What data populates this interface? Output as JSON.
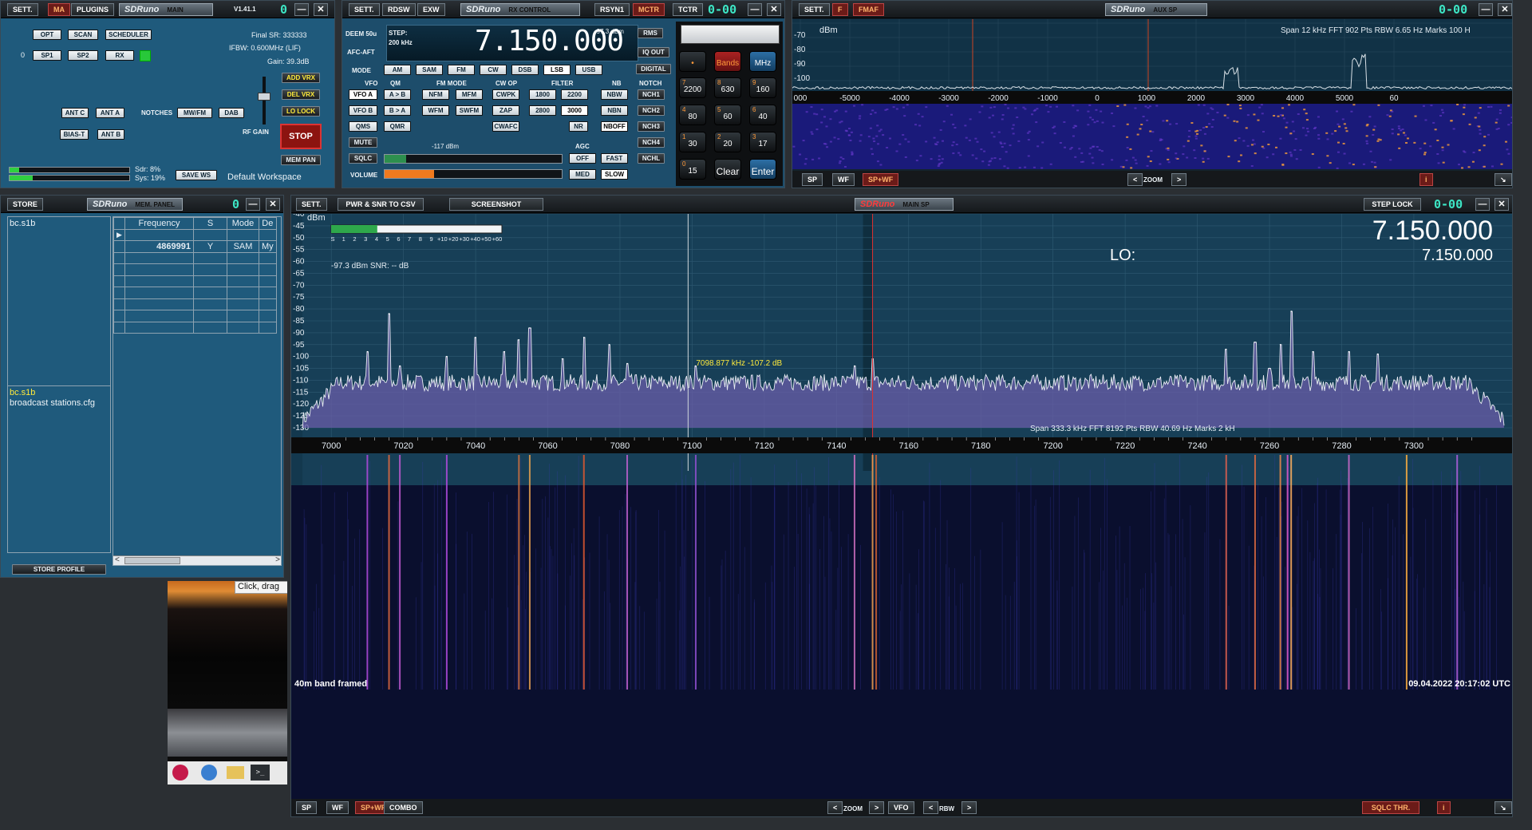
{
  "main": {
    "sett": "SETT.",
    "ma": "MA",
    "plugins": "PLUGINS",
    "logo": "SDRuno",
    "logo_sub": "MAIN",
    "version": "V1.41.1",
    "digit": "0",
    "btns": [
      "OPT",
      "SCAN",
      "SCHEDULER",
      "SP1",
      "SP2",
      "RX"
    ],
    "zero": "0",
    "final_sr": "Final SR: 333333",
    "ifbw": "IFBW: 0.600MHz (LIF)",
    "gain": "Gain: 39.3dB",
    "add_vrx": "ADD VRX",
    "del_vrx": "DEL VRX",
    "lo_lock": "LO LOCK",
    "ant_c": "ANT C",
    "ant_a": "ANT A",
    "notches": "NOTCHES",
    "mwfm": "MW/FM",
    "dab": "DAB",
    "biast": "BIAS-T",
    "ant_b": "ANT B",
    "rf_gain": "RF GAIN",
    "stop": "STOP",
    "mem_pan": "MEM PAN",
    "sdr": "Sdr: 8%",
    "sys": "Sys: 19%",
    "save_ws": "SAVE WS",
    "workspace": "Default Workspace",
    "sdr_load": 0.08,
    "sys_load": 0.19
  },
  "rx": {
    "sett": "SETT.",
    "rdsw": "RDSW",
    "exw": "EXW",
    "logo": "SDRuno",
    "logo_sub": "RX CONTROL",
    "rsyn": "RSYN1",
    "mctr": "MCTR",
    "tctr": "TCTR",
    "digit": "0-00",
    "deem": "DEEM 50u",
    "step": "STEP:",
    "step_val": "200 kHz",
    "afc": "AFC-AFT",
    "freq": "7.150.000",
    "dbm": "-97.3 dBm",
    "rms": "RMS",
    "iq_out": "IQ OUT",
    "digital": "DIGITAL",
    "mode": "MODE",
    "modes": [
      "AM",
      "SAM",
      "FM",
      "CW",
      "DSB",
      "LSB",
      "USB"
    ],
    "vfo": "VFO",
    "qm": "QM",
    "fm_mode": "FM MODE",
    "cw_op": "CW OP",
    "filter": "FILTER",
    "nb": "NB",
    "notch": "NOTCH",
    "row1": [
      "VFO A",
      "A > B",
      "NFM",
      "MFM",
      "CWPK",
      "1800",
      "2200",
      "NBW",
      "NCH1"
    ],
    "row2": [
      "VFO B",
      "B > A",
      "WFM",
      "SWFM",
      "ZAP",
      "2800",
      "3000",
      "NBN",
      "NCH2"
    ],
    "row3": [
      "QMS",
      "QMR",
      "CWAFC",
      "NR",
      "NBOFF",
      "NCH3"
    ],
    "mute": "MUTE",
    "sm_dbm": "-117 dBm",
    "agc": "AGC",
    "nch4": "NCH4",
    "sqlc": "SQLC",
    "off": "OFF",
    "fast": "FAST",
    "nchl": "NCHL",
    "volume": "VOLUME",
    "med": "MED",
    "slow": "SLOW",
    "squelch_level": 0.12,
    "volume_level": 0.28,
    "keypad": [
      {
        "n": "",
        "v": "•"
      },
      {
        "n": "",
        "v": "Bands"
      },
      {
        "n": "",
        "v": "MHz"
      },
      {
        "n": "7",
        "v": "2200"
      },
      {
        "n": "8",
        "v": "630"
      },
      {
        "n": "9",
        "v": "160"
      },
      {
        "n": "4",
        "v": "80"
      },
      {
        "n": "5",
        "v": "60"
      },
      {
        "n": "6",
        "v": "40"
      },
      {
        "n": "1",
        "v": "30"
      },
      {
        "n": "2",
        "v": "20"
      },
      {
        "n": "3",
        "v": "17"
      },
      {
        "n": "0",
        "v": "15"
      },
      {
        "n": "",
        "v": "Clear"
      },
      {
        "n": "",
        "v": "Enter"
      }
    ]
  },
  "aux": {
    "sett": "SETT.",
    "f": "F",
    "fmaf": "FMAF",
    "logo": "SDRuno",
    "logo_sub": "AUX SP",
    "digit": "0-00",
    "dbm": "dBm",
    "info": "Span 12 kHz   FFT 902 Pts   RBW 6.65 Hz   Marks 100 H",
    "ylabels": [
      "-70",
      "-80",
      "-90",
      "-100"
    ],
    "xlabels": [
      "000",
      "-5000",
      "-4000",
      "-3000",
      "-2000",
      "-1000",
      "0",
      "1000",
      "2000",
      "3000",
      "4000",
      "5000",
      "60"
    ],
    "sp": "SP",
    "wf": "WF",
    "spwf": "SP+WF",
    "zoom": "ZOOM",
    "lt": "<",
    "gt": ">",
    "i": "i"
  },
  "mem": {
    "store": "STORE",
    "logo": "SDRuno",
    "logo_sub": "MEM. PANEL",
    "digit": "0",
    "file1": "bc.s1b",
    "file_sel": "bc.s1b",
    "file2": "broadcast stations.cfg",
    "headers": [
      "Frequency",
      "S",
      "Mode",
      "De"
    ],
    "row": {
      "freq": "4869991",
      "s": "Y",
      "mode": "SAM",
      "desc": "My"
    },
    "store_profile": "STORE PROFILE",
    "lt": "<",
    "gt": ">",
    "tooltip": "Click, drag"
  },
  "mainsp": {
    "sett": "SETT.",
    "pwr": "PWR & SNR TO CSV",
    "screenshot": "SCREENSHOT",
    "logo": "SDRuno",
    "logo_sub": "MAIN SP",
    "step_lock": "STEP LOCK",
    "digit": "0-00",
    "dbm": "dBm",
    "smeter_scale": [
      "S",
      "1",
      "2",
      "3",
      "4",
      "5",
      "6",
      "7",
      "8",
      "9",
      "+10",
      "+20",
      "+30",
      "+40",
      "+50",
      "+60"
    ],
    "smeter_level": 0.27,
    "readout": "-97.3 dBm   SNR: -- dB",
    "freq": "7.150.000",
    "lo_label": "LO:",
    "lo_freq": "7.150.000",
    "marker": "7098.877 kHz -107.2 dB",
    "info": "Span 333.3 kHz   FFT 8192 Pts   RBW 40.69 Hz   Marks 2 kH",
    "caption": "40m band framed",
    "timestamp": "09.04.2022 20:17:02 UTC",
    "sp": "SP",
    "wf": "WF",
    "spwf": "SP+WF",
    "combo": "COMBO",
    "zoom": "ZOOM",
    "vfo": "VFO",
    "rbw": "RBW",
    "lt": "<",
    "gt": ">",
    "sqlc_thr": "SQLC THR.",
    "i": "i"
  },
  "chart_data": {
    "type": "line",
    "title": "",
    "xlabel": "",
    "ylabel": "dBm",
    "xlim": [
      6992,
      7325
    ],
    "ylim": [
      -130,
      -40
    ],
    "x_ticks": [
      7000,
      7020,
      7040,
      7060,
      7080,
      7100,
      7120,
      7140,
      7160,
      7180,
      7200,
      7220,
      7240,
      7260,
      7280,
      7300
    ],
    "y_ticks": [
      -40,
      -45,
      -50,
      -55,
      -60,
      -65,
      -70,
      -75,
      -80,
      -85,
      -90,
      -95,
      -100,
      -105,
      -110,
      -115,
      -120,
      -125,
      -130
    ],
    "noise_floor_dbm": -111,
    "peaks": [
      {
        "x": 7010,
        "y": -98
      },
      {
        "x": 7016,
        "y": -82
      },
      {
        "x": 7019,
        "y": -104
      },
      {
        "x": 7032,
        "y": -100
      },
      {
        "x": 7040,
        "y": -92
      },
      {
        "x": 7048,
        "y": -98
      },
      {
        "x": 7052,
        "y": -93
      },
      {
        "x": 7055,
        "y": -88
      },
      {
        "x": 7064,
        "y": -101
      },
      {
        "x": 7070,
        "y": -92
      },
      {
        "x": 7077,
        "y": -95
      },
      {
        "x": 7082,
        "y": -103
      },
      {
        "x": 7101,
        "y": -104
      },
      {
        "x": 7145,
        "y": -104
      },
      {
        "x": 7150,
        "y": -101
      },
      {
        "x": 7248,
        "y": -97
      },
      {
        "x": 7256,
        "y": -94
      },
      {
        "x": 7260,
        "y": -105
      },
      {
        "x": 7263,
        "y": -95
      },
      {
        "x": 7266,
        "y": -81
      },
      {
        "x": 7272,
        "y": -98
      },
      {
        "x": 7282,
        "y": -98
      },
      {
        "x": 7290,
        "y": -99
      }
    ],
    "marker": {
      "x": 7098.877,
      "y": -107.2
    },
    "vfo_x": 7150,
    "grid": true
  }
}
